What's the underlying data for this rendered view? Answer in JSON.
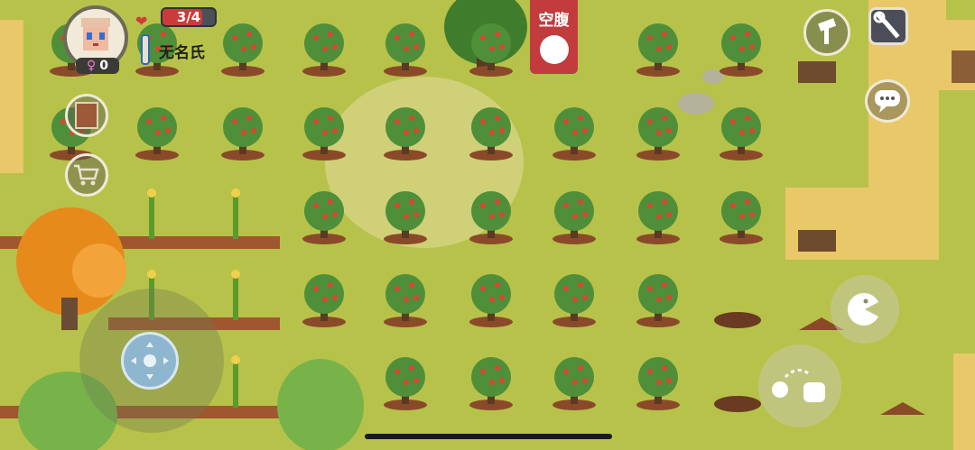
{
  "hud": {
    "health_text": "3/4",
    "health_fraction": 0.75,
    "player_name": "无名氏",
    "gender_count": "0",
    "gender_symbol": "♀",
    "status_label": "空腹"
  },
  "colors": {
    "grass": "#b7c24a",
    "dirt_path": "#e9c86a",
    "health_bar": "#cc3b3b",
    "status_tag": "#c23b3d"
  },
  "icons": {
    "profile": "avatar",
    "health": "heart-icon",
    "temperature": "thermometer-icon",
    "journal": "book-icon",
    "shop": "shopping-cart-icon",
    "build": "hammer-icon",
    "settings": "wrench-icon",
    "chat": "chat-bubble-icon",
    "eat": "pacman-eat-icon",
    "throw": "throw-hand-icon",
    "hunger": "hungry-face-icon"
  }
}
